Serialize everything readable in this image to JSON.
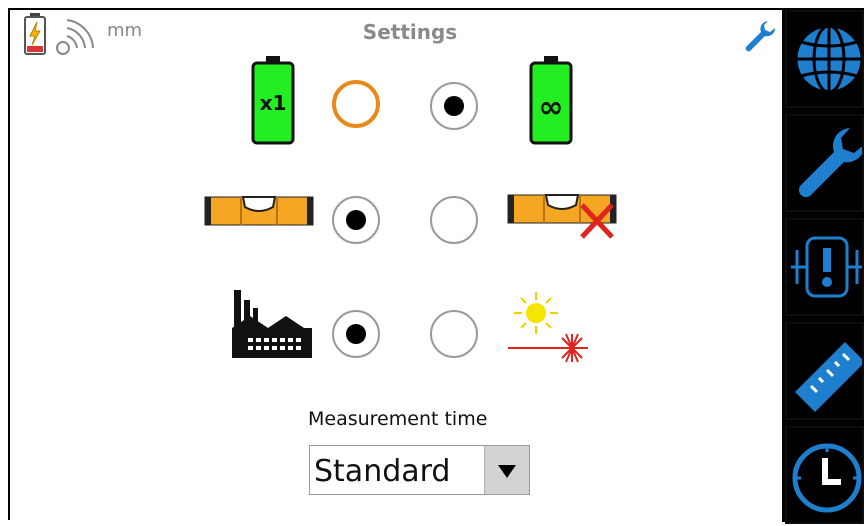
{
  "header": {
    "title": "Settings",
    "unit": "mm",
    "icons": [
      "battery-charging-icon",
      "wireless-signal-icon",
      "wrench-icon"
    ]
  },
  "settings_rows": [
    {
      "left_icon": "battery-single-charge-icon",
      "left_icon_text": "x1",
      "right_icon": "battery-continuous-icon",
      "right_icon_text": "∞",
      "selected": "right",
      "focused": "left"
    },
    {
      "left_icon": "spirit-level-icon",
      "right_icon": "spirit-level-off-icon",
      "selected": "left"
    },
    {
      "left_icon": "factory-icon",
      "right_icon": "sunlight-laser-icon",
      "selected": "left"
    }
  ],
  "measurement_time": {
    "label": "Measurement time",
    "value": "Standard"
  },
  "sidebar": {
    "items": [
      {
        "name": "globe"
      },
      {
        "name": "wrench"
      },
      {
        "name": "machine-alignment"
      },
      {
        "name": "ruler"
      },
      {
        "name": "clock"
      }
    ]
  },
  "colors": {
    "accent_blue": "#1f7fcf",
    "battery_green": "#22ee22",
    "focus_orange": "#e8891a",
    "level_orange": "#f5a623",
    "title_gray": "#8a8a8a",
    "alert_red": "#e0231c"
  }
}
